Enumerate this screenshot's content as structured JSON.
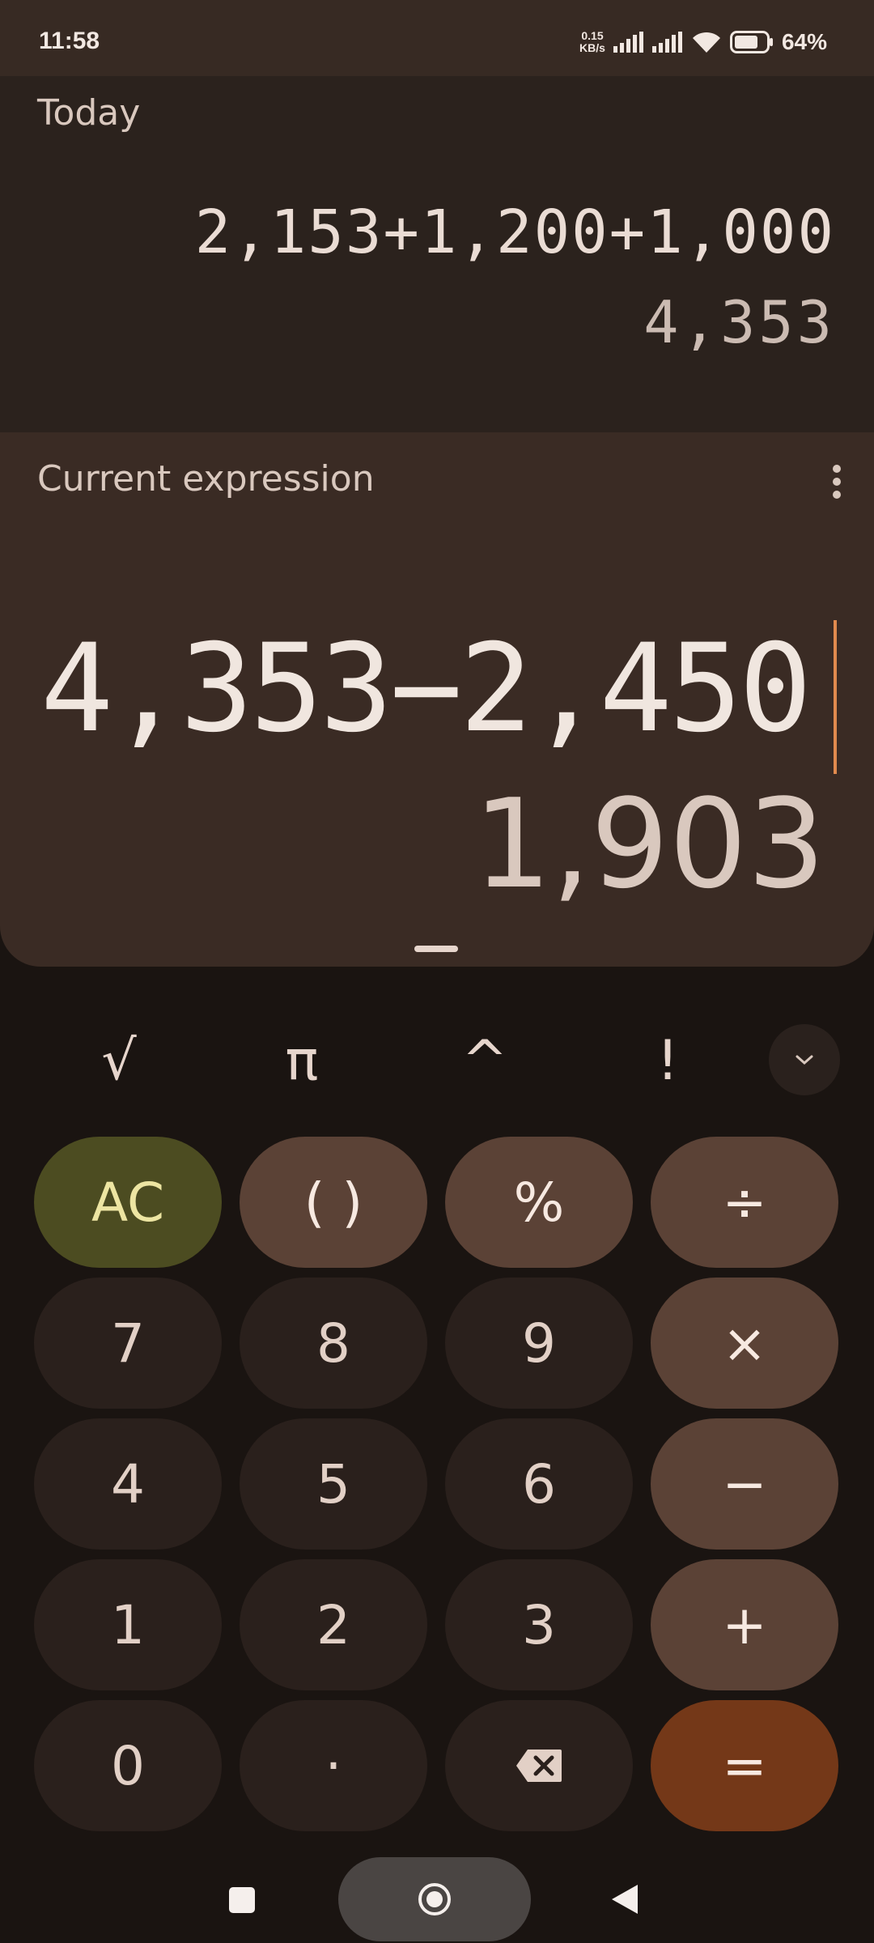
{
  "status": {
    "time": "11:58",
    "net_speed_value": "0.15",
    "net_speed_unit": "KB/s",
    "battery": "64%"
  },
  "history": {
    "label": "Today",
    "expression": "2,153+1,200+1,000",
    "result": "4,353"
  },
  "current": {
    "label": "Current expression",
    "expression": "4,353−2,450",
    "result": "1,903"
  },
  "scientific": {
    "sqrt": "√",
    "pi": "π",
    "power": "^",
    "factorial": "!"
  },
  "keypad": {
    "ac": "AC",
    "parens": "( )",
    "percent": "%",
    "divide": "÷",
    "seven": "7",
    "eight": "8",
    "nine": "9",
    "multiply": "×",
    "four": "4",
    "five": "5",
    "six": "6",
    "minus": "−",
    "one": "1",
    "two": "2",
    "three": "3",
    "plus": "+",
    "zero": "0",
    "decimal": "·",
    "equals": "="
  },
  "icons": {
    "menu": "more-vert-icon",
    "expand": "chevron-down-icon",
    "backspace": "backspace-icon",
    "nav_recents": "square-icon",
    "nav_home": "circle-icon",
    "nav_back": "triangle-back-icon"
  },
  "colors": {
    "ac_key": "#4c4c21",
    "operator_key": "#5b4236",
    "equals_key": "#743818",
    "cursor": "#e08a4e"
  }
}
